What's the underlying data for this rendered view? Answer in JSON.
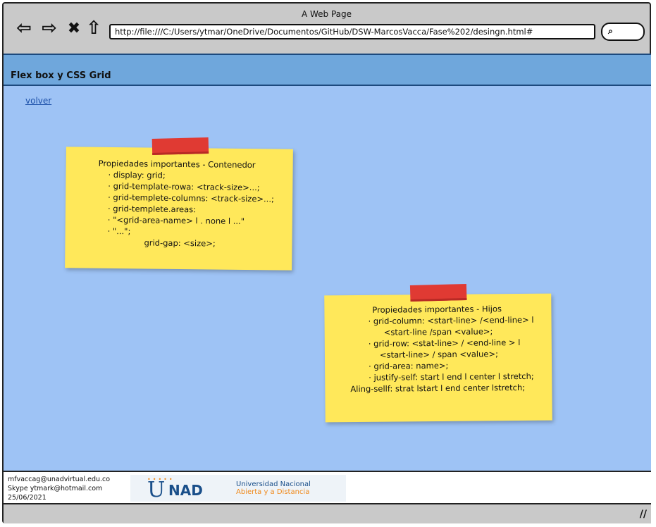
{
  "window": {
    "title": "A Web Page"
  },
  "browser": {
    "back_icon": "⇦",
    "forward_icon": "⇨",
    "close_icon": "✖",
    "home_icon": "⇧",
    "url": "http://file:///C:/Users/ytmar/OneDrive/Documentos/GitHub/DSW-MarcosVacca/Fase%202/desingn.html#",
    "search_icon": "⌕"
  },
  "header": {
    "title": "Flex box y CSS Grid"
  },
  "main": {
    "back_link": "volver",
    "note1": {
      "title": "Propiedades importantes - Contenedor",
      "lines": [
        "· display: grid;",
        "· grid-template-rowa: <track-size>...;",
        "· grid-templete-columns: <track-size>...;",
        "· grid-templete.areas:",
        "· \"<grid-area-name> l . none l ...\"",
        "· \"...\";",
        "grid-gap: <size>;"
      ]
    },
    "note2": {
      "title": "Propiedades importantes - Hijos",
      "lines": [
        "· grid-column: <start-line> /<end-line> l",
        "<start-line /span <value>;",
        "· grid-row: <stat-line> / <end-line > l",
        "<start-line> / span <value>;",
        "· grid-area: name>;",
        "· justify-self: start l end l center l stretch;",
        "Aling-sellf: strat lstart l end center lstretch;"
      ]
    }
  },
  "footer": {
    "email": "mfvaccag@unadvirtual.edu.co",
    "skype": "Skype ytmark@hotmail.com",
    "date": "25/06/2021",
    "logo": {
      "u": "U",
      "nad": "NAD",
      "line1": "Universidad Nacional",
      "line2": "Abierta y a Distancia"
    }
  },
  "colors": {
    "header_bg": "#6fa7dc",
    "content_bg": "#9ec3f5",
    "note_bg": "#ffe85a",
    "tape": "#e03a33",
    "link": "#1b4fa8"
  },
  "status": {
    "resize_icon": "//"
  }
}
